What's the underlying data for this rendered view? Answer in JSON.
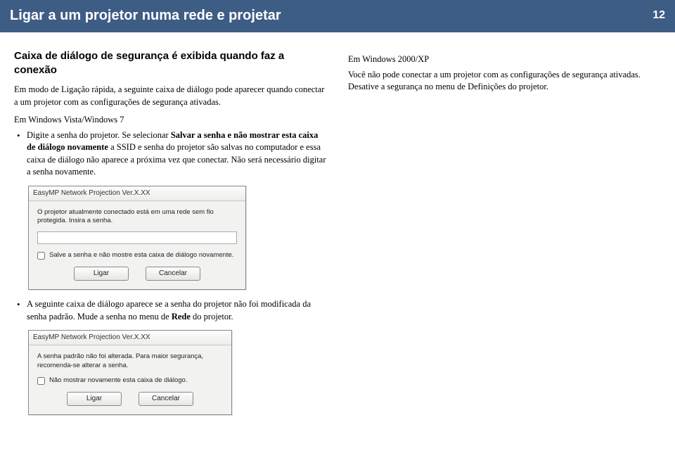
{
  "header": {
    "title": "Ligar a um projetor numa rede e projetar",
    "page": "12"
  },
  "left": {
    "heading": "Caixa de diálogo de segurança é exibida quando faz a conexão",
    "intro": "Em modo de Ligação rápida, a seguinte caixa de diálogo pode aparecer quando conectar a um projetor com as configurações de segurança ativadas.",
    "os1": "Em Windows Vista/Windows 7",
    "bullet1a": "Digite a senha do projetor. Se selecionar ",
    "bullet1b_bold": "Salvar a senha e não mostrar esta caixa de diálogo novamente",
    "bullet1c": " a SSID e senha do projetor são salvas no computador e essa caixa de diálogo não aparece a próxima vez que conectar. Não será necessário digitar a senha novamente.",
    "bullet2a": "A seguinte caixa de diálogo aparece se a senha do projetor não foi modificada da senha padrão. Mude a senha no menu de ",
    "bullet2b_bold": "Rede",
    "bullet2c": " do projetor."
  },
  "right": {
    "os2": "Em Windows 2000/XP",
    "para": "Você não pode conectar a um projetor com as configurações de segurança ativadas. Desative a segurança no menu de Definições do projetor."
  },
  "dialog1": {
    "title": "EasyMP Network Projection Ver.X.XX",
    "msg": "O projetor atualmente conectado está em uma rede sem fio protegida.\nInsira a senha.",
    "input_value": "",
    "chk": "Salve a senha e não mostre esta caixa de diálogo novamente.",
    "btn_ok": "Ligar",
    "btn_cancel": "Cancelar"
  },
  "dialog2": {
    "title": "EasyMP Network Projection Ver.X.XX",
    "msg": "A senha padrão não foi alterada.\nPara maior segurança, recomenda-se alterar a senha.",
    "chk": "Não mostrar novamente esta caixa de diálogo.",
    "btn_ok": "Ligar",
    "btn_cancel": "Cancelar"
  }
}
